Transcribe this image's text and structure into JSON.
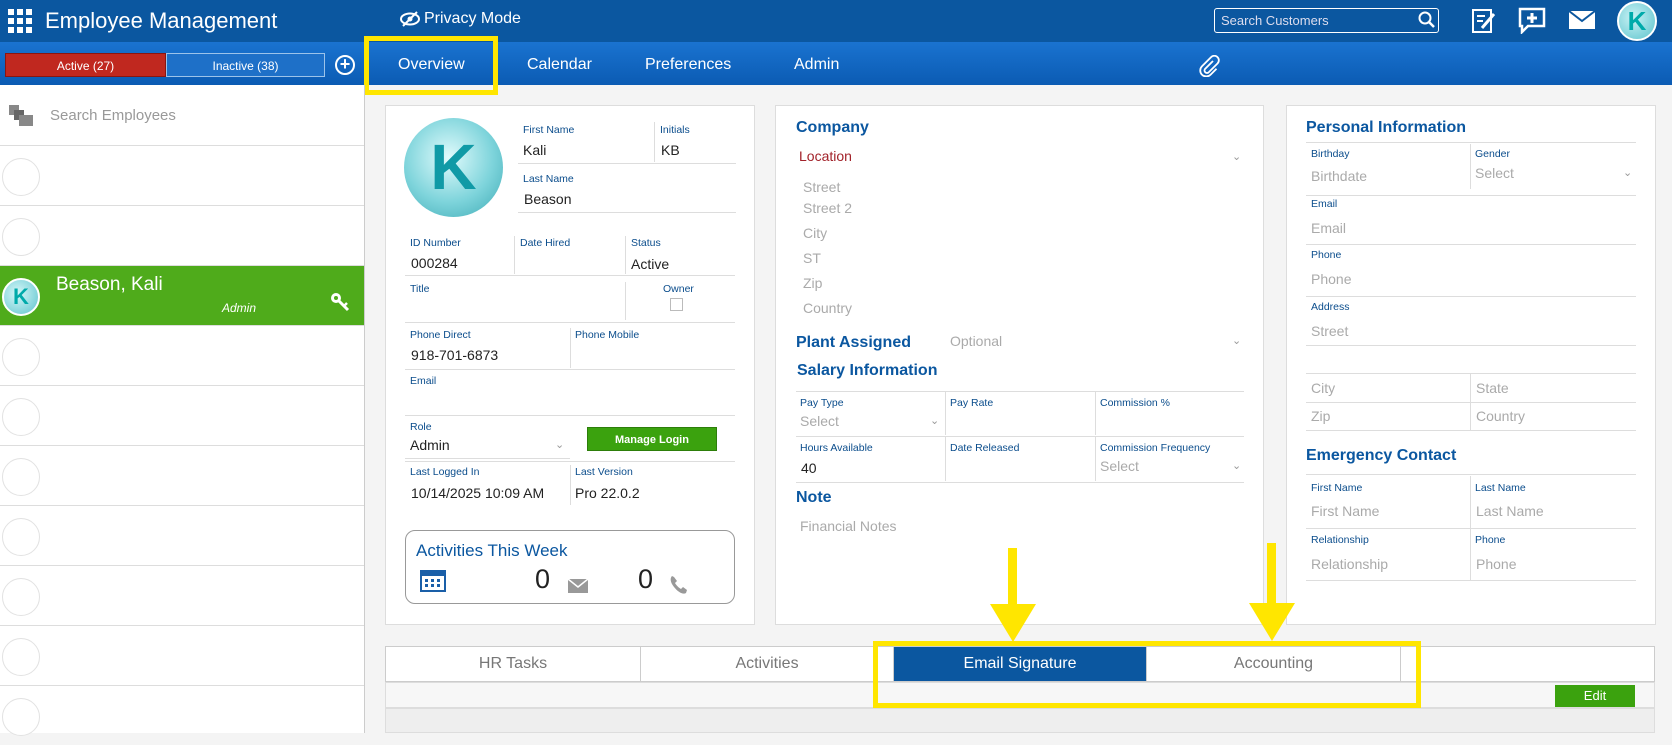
{
  "header": {
    "app_title": "Employee Management",
    "privacy_mode": "Privacy Mode",
    "search_placeholder": "Search Customers",
    "avatar_initial": "K"
  },
  "nav": {
    "active_tab": "Active (27)",
    "inactive_tab": "Inactive (38)",
    "add": "+",
    "items": [
      "Overview",
      "Calendar",
      "Preferences",
      "Admin"
    ]
  },
  "sidebar": {
    "search_placeholder": "Search Employees",
    "selected": {
      "name": "Beason, Kali",
      "role": "Admin",
      "initial": "K"
    }
  },
  "profile": {
    "avatar_initial": "K",
    "first_name_label": "First Name",
    "first_name": "Kali",
    "initials_label": "Initials",
    "initials": "KB",
    "last_name_label": "Last Name",
    "last_name": "Beason",
    "id_label": "ID Number",
    "id": "000284",
    "date_hired_label": "Date Hired",
    "status_label": "Status",
    "status": "Active",
    "title_label": "Title",
    "owner_label": "Owner",
    "phone_direct_label": "Phone Direct",
    "phone_direct": "918-701-6873",
    "phone_mobile_label": "Phone Mobile",
    "email_label": "Email",
    "role_label": "Role",
    "role": "Admin",
    "manage_login": "Manage Login",
    "last_logged_label": "Last Logged In",
    "last_logged": "10/14/2025 10:09 AM",
    "last_version_label": "Last Version",
    "last_version": "Pro 22.0.2",
    "activities_title": "Activities This Week",
    "activities_emails": "0",
    "activities_calls": "0"
  },
  "company": {
    "title": "Company",
    "location": "Location",
    "street": "Street",
    "street2": "Street 2",
    "city": "City",
    "st": "ST",
    "zip": "Zip",
    "country": "Country",
    "plant_title": "Plant Assigned",
    "plant_placeholder": "Optional",
    "salary_title": "Salary Information",
    "pay_type_label": "Pay Type",
    "pay_type": "Select",
    "pay_rate_label": "Pay Rate",
    "commission_label": "Commission %",
    "hours_label": "Hours Available",
    "hours": "40",
    "date_released_label": "Date Released",
    "commission_freq_label": "Commission Frequency",
    "commission_freq": "Select",
    "note_title": "Note",
    "note_placeholder": "Financial Notes"
  },
  "personal": {
    "title": "Personal Information",
    "birthday_label": "Birthday",
    "birthday_ph": "Birthdate",
    "gender_label": "Gender",
    "gender_ph": "Select",
    "email_label": "Email",
    "email_ph": "Email",
    "phone_label": "Phone",
    "phone_ph": "Phone",
    "address_label": "Address",
    "street_ph": "Street",
    "city_ph": "City",
    "state_ph": "State",
    "zip_ph": "Zip",
    "country_ph": "Country",
    "emergency_title": "Emergency Contact",
    "ec_first_label": "First Name",
    "ec_first_ph": "First Name",
    "ec_last_label": "Last Name",
    "ec_last_ph": "Last Name",
    "ec_rel_label": "Relationship",
    "ec_rel_ph": "Relationship",
    "ec_phone_label": "Phone",
    "ec_phone_ph": "Phone"
  },
  "tabs": {
    "items": [
      "HR Tasks",
      "Activities",
      "Email Signature",
      "Accounting"
    ],
    "edit": "Edit"
  },
  "colors": {
    "primary": "#0b57a0",
    "highlight": "#ffe600",
    "green": "#3ba20e",
    "red": "#c0281f"
  }
}
